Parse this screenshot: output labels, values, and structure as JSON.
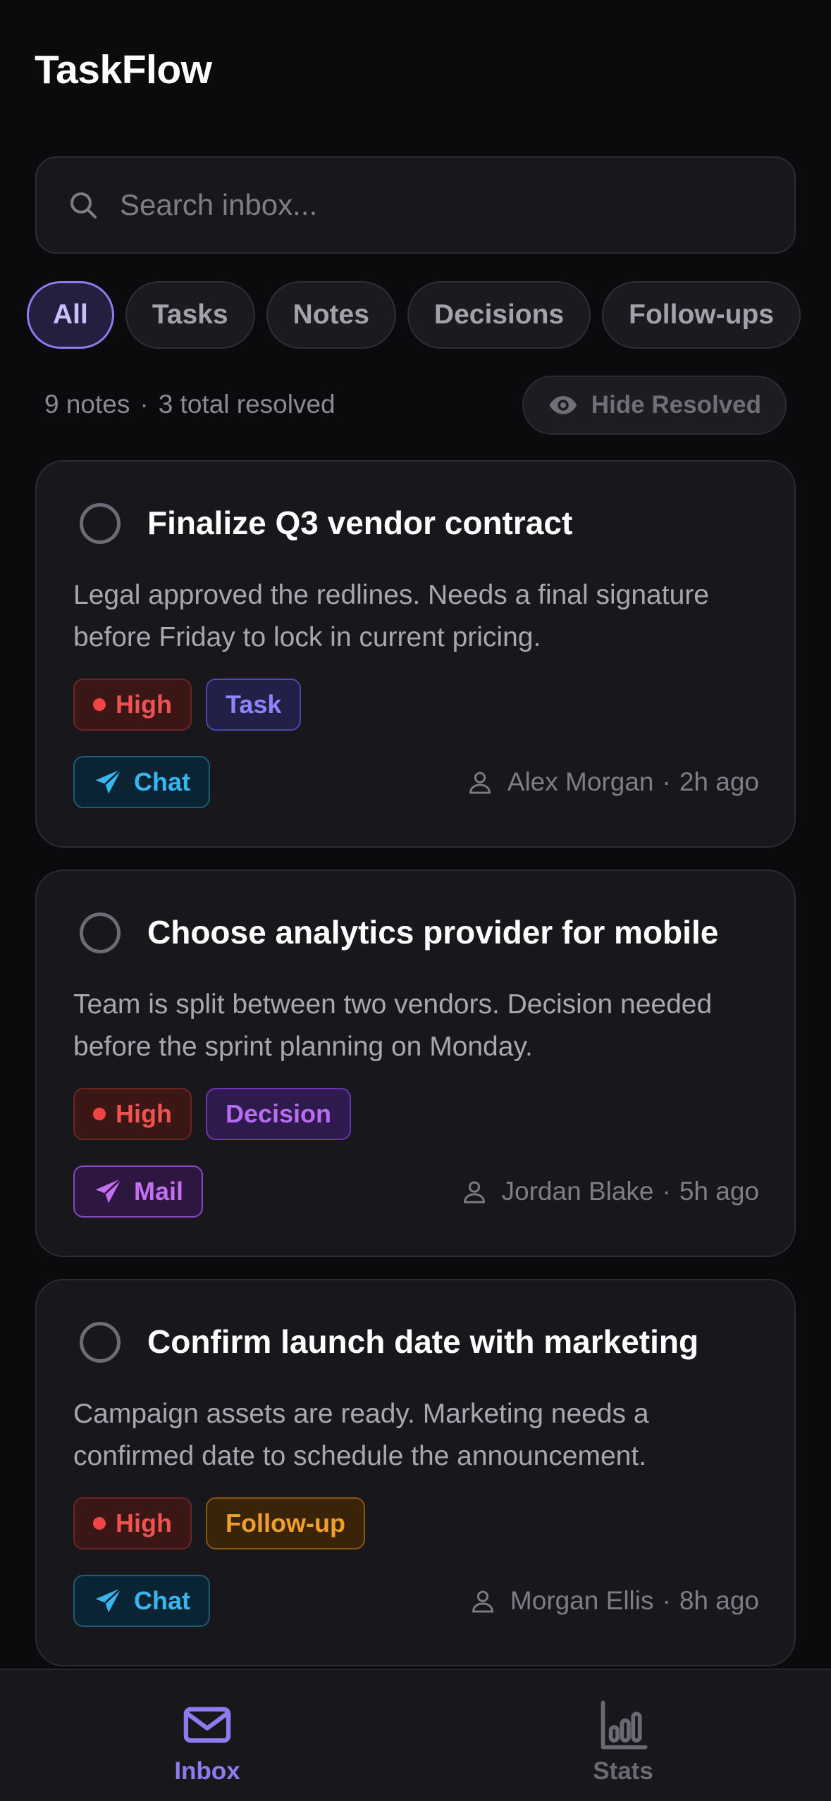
{
  "app": {
    "title": "TaskFlow"
  },
  "search": {
    "placeholder": "Search inbox..."
  },
  "filters": [
    {
      "label": "All",
      "active": true
    },
    {
      "label": "Tasks",
      "active": false
    },
    {
      "label": "Notes",
      "active": false
    },
    {
      "label": "Decisions",
      "active": false
    },
    {
      "label": "Follow-ups",
      "active": false
    }
  ],
  "summary": {
    "notes": "9 notes",
    "separator": "·",
    "resolved": "3 total resolved",
    "hide_resolved_label": "Hide Resolved"
  },
  "cards": [
    {
      "title": "Finalize Q3 vendor contract",
      "body": "Legal approved the redlines. Needs a final signature before Friday to lock in current pricing.",
      "priority": "High",
      "type": "Task",
      "source": "Chat",
      "author": "Alex Morgan",
      "time": "2h ago"
    },
    {
      "title": "Choose analytics provider for mobile",
      "body": "Team is split between two vendors. Decision needed before the sprint planning on Monday.",
      "priority": "High",
      "type": "Decision",
      "source": "Mail",
      "author": "Jordan Blake",
      "time": "5h ago"
    },
    {
      "title": "Confirm launch date with marketing",
      "body": "Campaign assets are ready. Marketing needs a confirmed date to schedule the announcement.",
      "priority": "High",
      "type": "Follow-up",
      "source": "Chat",
      "author": "Morgan Ellis",
      "time": "8h ago"
    }
  ],
  "meta_separator": "·",
  "tabbar": {
    "inbox": "Inbox",
    "stats": "Stats",
    "active": "Inbox"
  },
  "colors": {
    "accent": "#8b7cf2",
    "high": "#f05252",
    "task": "#8f84ff",
    "decision": "#b86cf0",
    "followup": "#f0a02a",
    "chat": "#38b6f0",
    "mail": "#c36ff0"
  }
}
